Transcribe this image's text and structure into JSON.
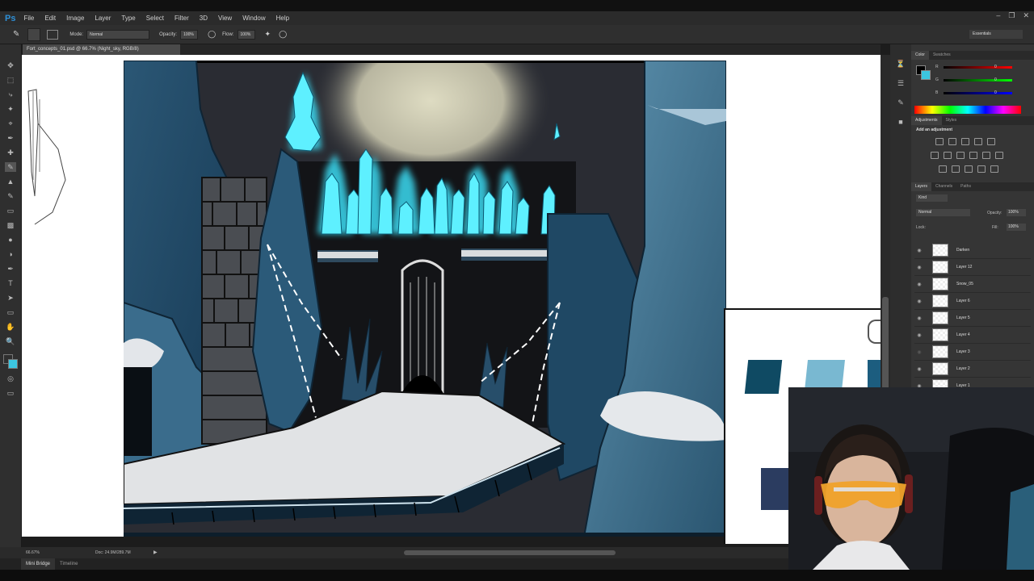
{
  "app": {
    "logo": "Ps"
  },
  "menu": [
    "File",
    "Edit",
    "Image",
    "Layer",
    "Type",
    "Select",
    "Filter",
    "3D",
    "View",
    "Window",
    "Help"
  ],
  "options_bar": {
    "mode_label": "Mode:",
    "mode_value": "Normal",
    "opacity_label": "Opacity:",
    "opacity_value": "100%",
    "flow_label": "Flow:",
    "flow_value": "100%",
    "workspace": "Essentials"
  },
  "document": {
    "tab": "Fort_concepts_01.psd @ 66.7% (Night_sky, RGB/8)"
  },
  "color_panel": {
    "tabs": [
      "Color",
      "Swatches"
    ],
    "r": "0",
    "g": "0",
    "b": "0",
    "foreground": "#000000",
    "background": "#3cc6e0"
  },
  "adjustments_panel": {
    "tabs": [
      "Adjustments",
      "Styles"
    ],
    "heading": "Add an adjustment"
  },
  "layers_panel": {
    "tabs": [
      "Layers",
      "Channels",
      "Paths"
    ],
    "filter": "Kind",
    "blend_mode": "Normal",
    "opacity_label": "Opacity:",
    "opacity_value": "100%",
    "lock_label": "Lock:",
    "fill_label": "Fill:",
    "fill_value": "100%",
    "layers": [
      "Darken",
      "Layer 12",
      "Snow_05",
      "Layer 6",
      "Layer 5",
      "Layer 4",
      "Layer 3",
      "Layer 2",
      "Layer 1"
    ]
  },
  "status": {
    "zoom": "66.67%",
    "doc": "Doc: 24.9M/289.7M"
  },
  "bottom_tabs": [
    "Mini Bridge",
    "Timeline"
  ],
  "colors": {
    "accent": "#3cc6e0",
    "panel": "#353535",
    "chrome": "#2b2b2b"
  }
}
